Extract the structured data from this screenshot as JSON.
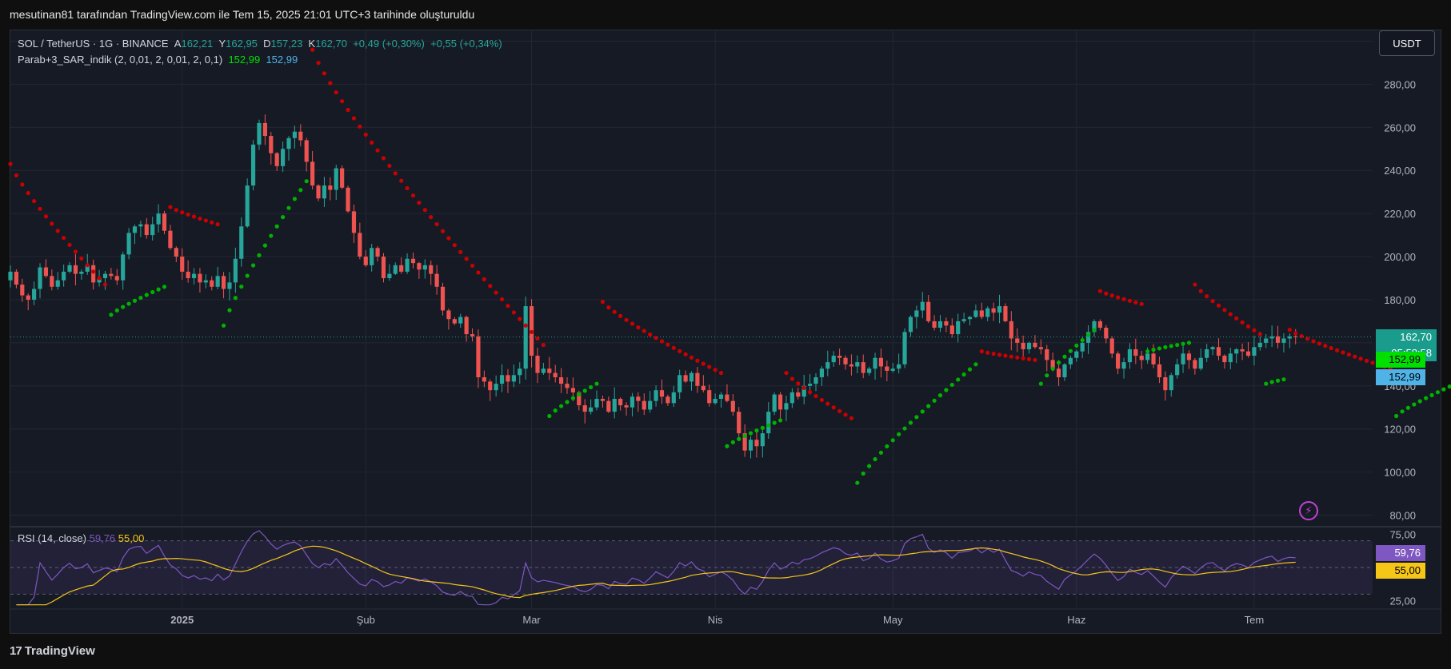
{
  "header": {
    "title": "mesutinan81 tarafından TradingView.com ile Tem 15, 2025 21:01 UTC+3 tarihinde oluşturuldu"
  },
  "legend": {
    "symbol": "SOL / TetherUS · 1G · BINANCE",
    "open_label": "A",
    "open": "162,21",
    "high_label": "Y",
    "high": "162,95",
    "low_label": "D",
    "low": "157,23",
    "close_label": "K",
    "close": "162,70",
    "change": "+0,49 (+0,30%)",
    "change2": "+0,55 (+0,34%)",
    "indicator": "Parab+3_SAR_indik (2, 0,01, 2, 0,01, 2, 0,1)",
    "indicator_v1": "152,99",
    "indicator_v2": "152,99"
  },
  "rsi_legend": {
    "label": "RSI (14, close)",
    "rsi": "59,76",
    "ma": "55,00"
  },
  "currency_button": "USDT",
  "badges": {
    "price": "162,70",
    "countdown": "05:58:58",
    "sar_green": "152,99",
    "sar_blue": "152,99",
    "rsi": "59,76",
    "rsi_ma": "55,00"
  },
  "brand": "TradingView",
  "colors": {
    "up": "#26a69a",
    "down": "#ef5350",
    "sar_up": "#00b300",
    "sar_down": "#cc0000",
    "rsi_line": "#7e57c2",
    "rsi_ma": "#f5c518",
    "price_badge": "#1a9c8c",
    "sar_green_badge": "#00e000",
    "sar_blue_badge": "#4fb3e8"
  },
  "chart_data": [
    {
      "type": "candlestick",
      "title": "SOL / TetherUS · 1G · BINANCE",
      "ylim": [
        75,
        305
      ],
      "y_ticks": [
        "80,00",
        "100,00",
        "120,00",
        "140,00",
        "160,00",
        "180,00",
        "200,00",
        "220,00",
        "240,00",
        "260,00",
        "280,00",
        "300,00"
      ],
      "y_tick_values": [
        80,
        100,
        120,
        140,
        160,
        180,
        200,
        220,
        240,
        260,
        280,
        300
      ],
      "x_labels": [
        "2025",
        "Şub",
        "Mar",
        "Nis",
        "May",
        "Haz",
        "Tem"
      ],
      "x_label_days": [
        2,
        33,
        61,
        92,
        122,
        153,
        183
      ],
      "day_start": -27,
      "day_end": 203,
      "closes": [
        193,
        187,
        182,
        180,
        185,
        195,
        191,
        186,
        189,
        193,
        196,
        192,
        193,
        196,
        188,
        190,
        192,
        191,
        189,
        201,
        211,
        214,
        215,
        210,
        215,
        220,
        212,
        204,
        200,
        193,
        190,
        192,
        188,
        189,
        186,
        191,
        185,
        188,
        199,
        214,
        233,
        252,
        262,
        256,
        248,
        242,
        250,
        255,
        258,
        254,
        244,
        233,
        227,
        233,
        231,
        241,
        232,
        221,
        211,
        200,
        196,
        204,
        200,
        190,
        192,
        196,
        193,
        199,
        197,
        194,
        196,
        192,
        186,
        175,
        171,
        169,
        172,
        164,
        163,
        144,
        142,
        138,
        141,
        145,
        142,
        145,
        148,
        177,
        154,
        146,
        148,
        146,
        144,
        141,
        139,
        137,
        131,
        128,
        130,
        134,
        133,
        128,
        134,
        131,
        130,
        135,
        133,
        129,
        133,
        138,
        135,
        132,
        137,
        145,
        142,
        146,
        140,
        138,
        132,
        134,
        136,
        133,
        128,
        118,
        110,
        115,
        112,
        118,
        128,
        136,
        129,
        132,
        137,
        135,
        140,
        141,
        144,
        148,
        151,
        154,
        153,
        150,
        149,
        151,
        146,
        148,
        153,
        149,
        147,
        148,
        150,
        165,
        172,
        175,
        179,
        170,
        167,
        170,
        168,
        164,
        170,
        171,
        172,
        175,
        172,
        176,
        174,
        177,
        170,
        162,
        160,
        157,
        160,
        158,
        157,
        152,
        148,
        144,
        150,
        153,
        156,
        160,
        165,
        170,
        167,
        162,
        155,
        148,
        151,
        157,
        154,
        152,
        155,
        150,
        144,
        138,
        145,
        150,
        155,
        152,
        148,
        153,
        157,
        158,
        154,
        151,
        155,
        157,
        156,
        154,
        158,
        160,
        162,
        163,
        160,
        162,
        163,
        162.7
      ],
      "sar": [
        {
          "side": "down",
          "start": -27,
          "v0": 243,
          "v1": 187,
          "n": 17
        },
        {
          "side": "up",
          "start": -10,
          "v0": 173,
          "v1": 186,
          "n": 10
        },
        {
          "side": "down",
          "start": 0,
          "v0": 223,
          "v1": 215,
          "n": 9
        },
        {
          "side": "up",
          "start": 9,
          "v0": 168,
          "v1": 235,
          "n": 15
        },
        {
          "side": "down",
          "start": 24,
          "v0": 296,
          "v1": 159,
          "n": 40
        },
        {
          "side": "up",
          "start": 64,
          "v0": 126,
          "v1": 141,
          "n": 9
        },
        {
          "side": "down",
          "start": 73,
          "v0": 179,
          "v1": 146,
          "n": 21
        },
        {
          "side": "up",
          "start": 94,
          "v0": 112,
          "v1": 124,
          "n": 10
        },
        {
          "side": "down",
          "start": 104,
          "v0": 146,
          "v1": 125,
          "n": 12
        },
        {
          "side": "up",
          "start": 116,
          "v0": 95,
          "v1": 150,
          "n": 21
        },
        {
          "side": "down",
          "start": 137,
          "v0": 156,
          "v1": 152,
          "n": 10
        },
        {
          "side": "up",
          "start": 147,
          "v0": 141,
          "v1": 166,
          "n": 10
        },
        {
          "side": "down",
          "start": 157,
          "v0": 184,
          "v1": 178,
          "n": 8
        },
        {
          "side": "up",
          "start": 165,
          "v0": 156,
          "v1": 160,
          "n": 8
        },
        {
          "side": "down",
          "start": 173,
          "v0": 187,
          "v1": 164,
          "n": 12
        },
        {
          "side": "up",
          "start": 185,
          "v0": 141,
          "v1": 143,
          "n": 4
        },
        {
          "side": "down",
          "start": 189,
          "v0": 166,
          "v1": 148,
          "n": 18
        },
        {
          "side": "up",
          "start": 207,
          "v0": 126,
          "v1": 153,
          "n": 21
        }
      ]
    },
    {
      "type": "line",
      "title": "RSI (14, close)",
      "ylim": [
        20,
        80
      ],
      "y_ticks": [
        "25,00",
        "75,00"
      ],
      "y_tick_values": [
        25,
        75
      ],
      "bands": [
        30,
        50,
        70
      ]
    }
  ]
}
